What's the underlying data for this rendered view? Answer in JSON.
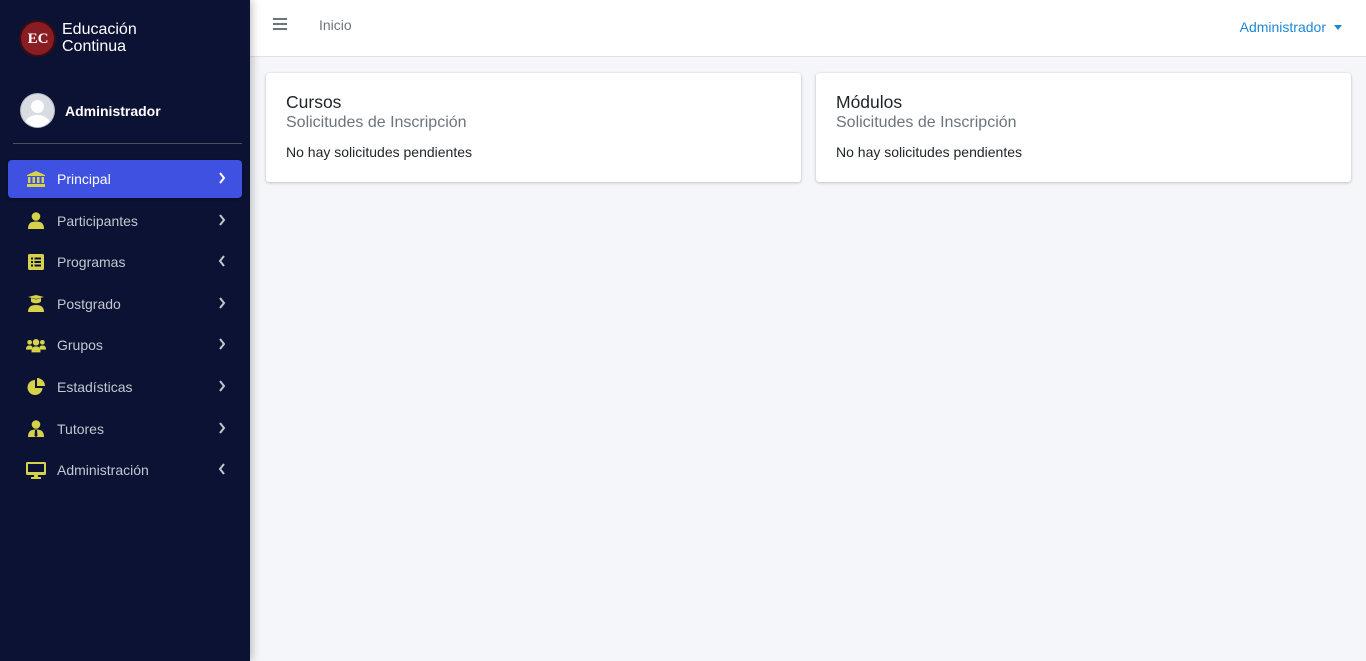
{
  "brand": {
    "line1": "Educación",
    "line2": "Continua",
    "logo_text": "EC",
    "logo_icon": "ec-logo-icon"
  },
  "user_panel": {
    "name": "Administrador",
    "avatar_icon": "user-avatar-icon"
  },
  "sidebar": {
    "items": [
      {
        "label": "Principal",
        "icon": "bank-icon",
        "chevron": "right",
        "active": true
      },
      {
        "label": "Participantes",
        "icon": "user-icon",
        "chevron": "right",
        "active": false
      },
      {
        "label": "Programas",
        "icon": "list-alt-icon",
        "chevron": "left",
        "active": false
      },
      {
        "label": "Postgrado",
        "icon": "graduate-icon",
        "chevron": "right",
        "active": false
      },
      {
        "label": "Grupos",
        "icon": "users-icon",
        "chevron": "right",
        "active": false
      },
      {
        "label": "Estadísticas",
        "icon": "pie-chart-icon",
        "chevron": "right",
        "active": false
      },
      {
        "label": "Tutores",
        "icon": "user-tie-icon",
        "chevron": "right",
        "active": false
      },
      {
        "label": "Administración",
        "icon": "desktop-icon",
        "chevron": "left",
        "active": false
      }
    ]
  },
  "topbar": {
    "menu_icon": "hamburger-icon",
    "home_link": "Inicio",
    "user_menu": "Administrador"
  },
  "cards": [
    {
      "title": "Cursos",
      "subtitle": "Solicitudes de Inscripción",
      "text": "No hay solicitudes pendientes"
    },
    {
      "title": "Módulos",
      "subtitle": "Solicitudes de Inscripción",
      "text": "No hay solicitudes pendientes"
    }
  ],
  "colors": {
    "sidebar_bg": "#0c1233",
    "active_item": "#3f51e0",
    "icon_yellow": "#d6d24a",
    "link_blue": "#1f88d6",
    "content_bg": "#f4f6f9"
  }
}
